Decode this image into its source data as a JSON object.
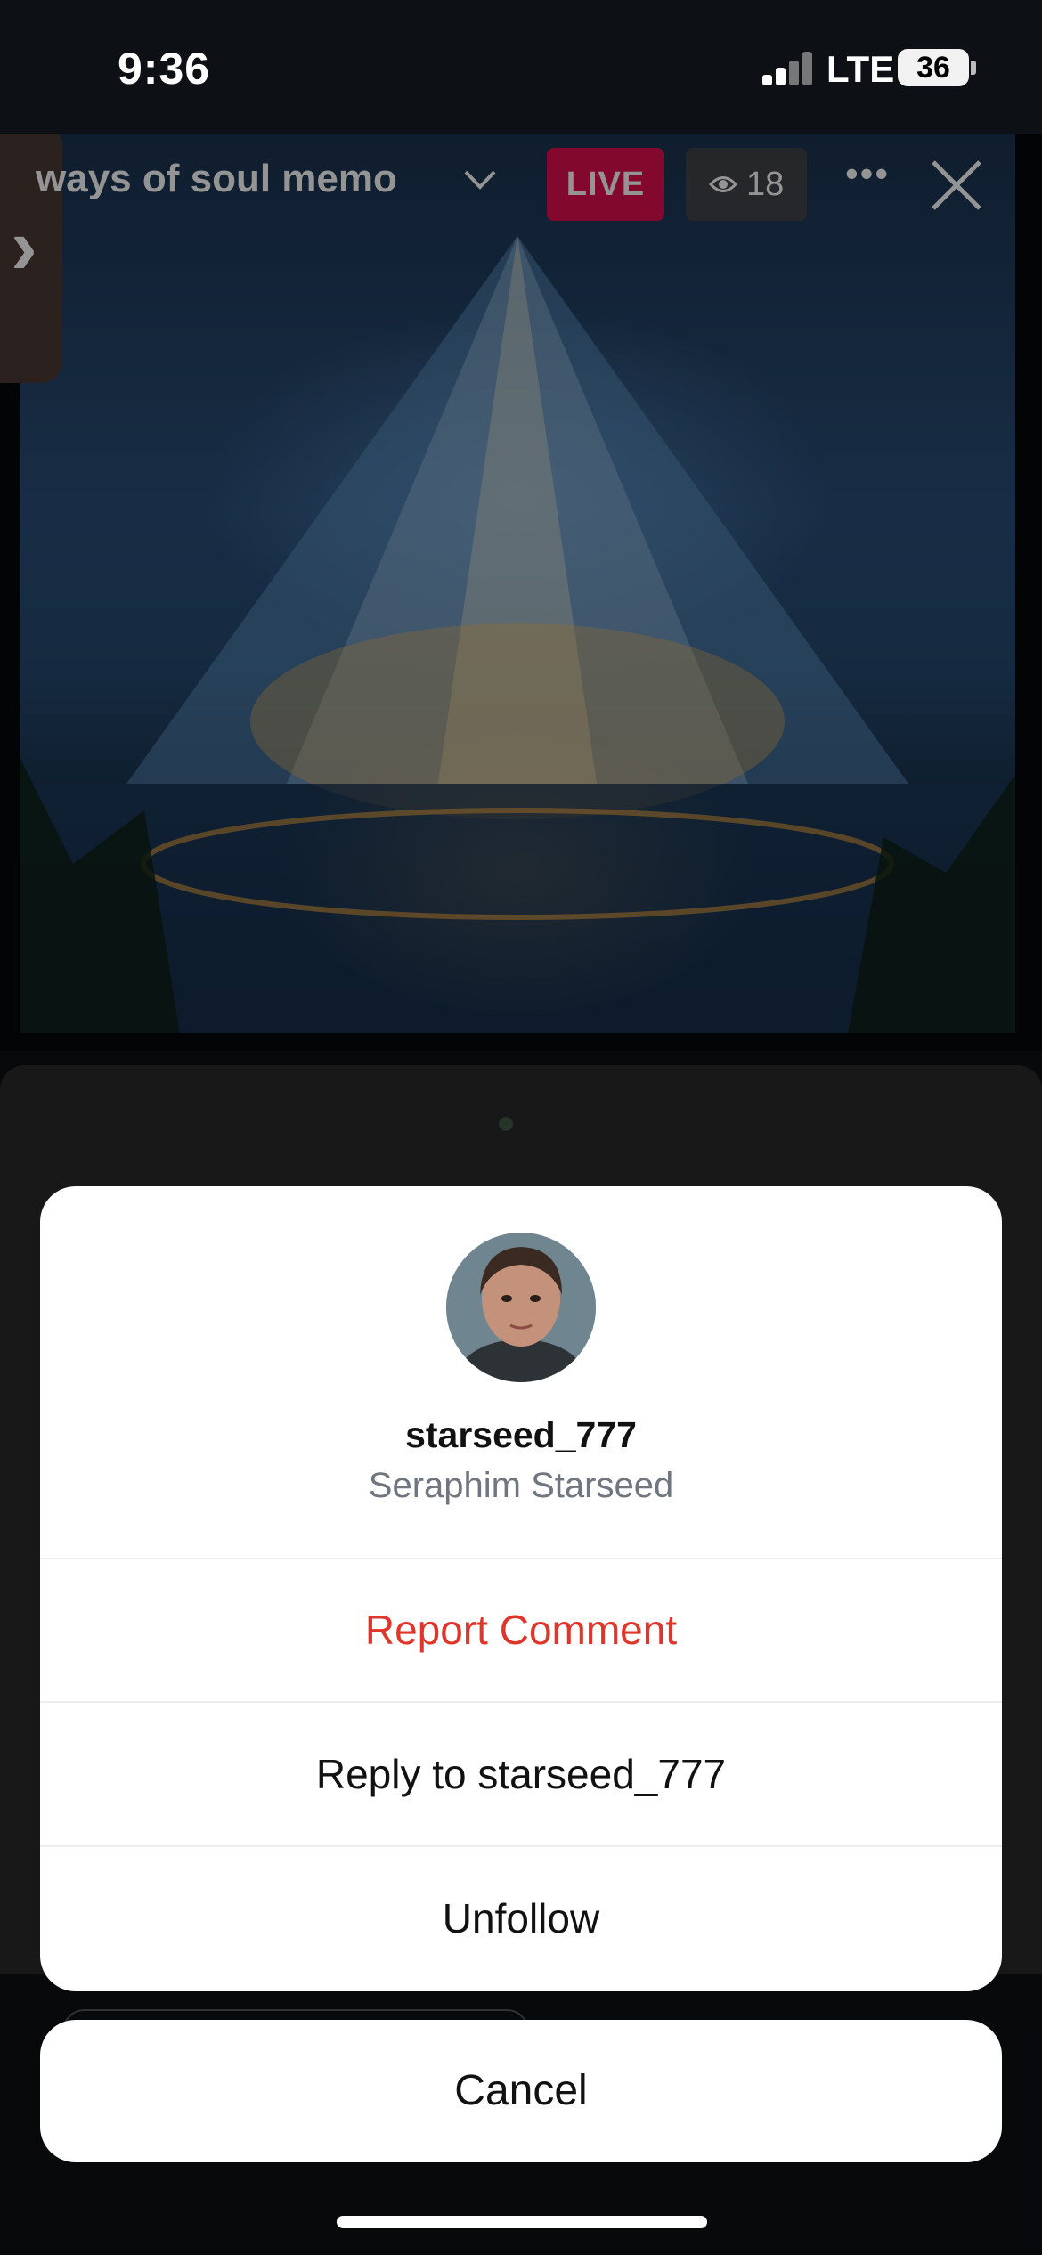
{
  "status_bar": {
    "time": "9:36",
    "network": "LTE",
    "battery": "36"
  },
  "stream": {
    "title": "ways of soul memo",
    "live_label": "LIVE",
    "viewer_count": "18"
  },
  "action_sheet": {
    "username": "starseed_777",
    "full_name": "Seraphim Starseed",
    "report_label": "Report Comment",
    "reply_label": "Reply to starseed_777",
    "unfollow_label": "Unfollow",
    "cancel_label": "Cancel"
  },
  "colors": {
    "live_badge": "#e0114f",
    "danger": "#e0352b",
    "secondary_text": "#6f7680"
  },
  "icons": [
    "signal-icon",
    "battery-icon",
    "chevron-right-icon",
    "chevron-down-icon",
    "eye-icon",
    "more-icon",
    "close-icon"
  ]
}
